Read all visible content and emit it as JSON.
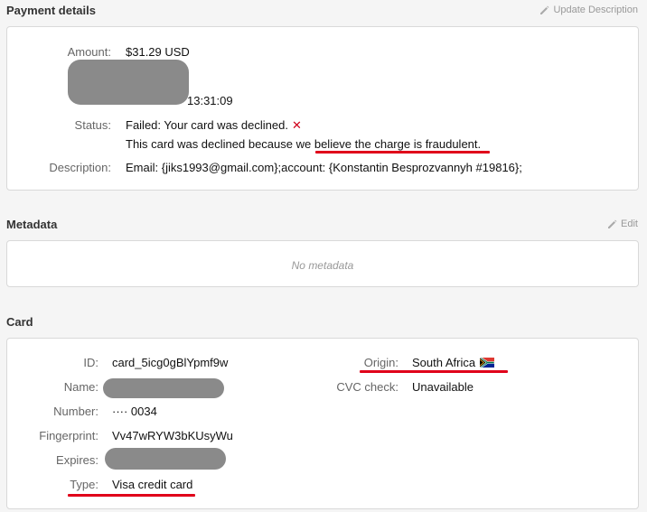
{
  "payment": {
    "title": "Payment details",
    "action_label": "Update Description",
    "amount_label": "Amount:",
    "amount_value": "$31.29 USD",
    "time_value": "13:31:09",
    "status_label": "Status:",
    "status_value": "Failed: Your card was declined.",
    "status_icon": "x-icon",
    "reason_prefix": "This card was declined because we ",
    "reason_highlight": "believe the charge is fraudulent.",
    "description_label": "Description:",
    "description_value": "Email: {jiks1993@gmail.com};account: {Konstantin Besprozvannyh #19816};"
  },
  "metadata": {
    "title": "Metadata",
    "action_label": "Edit",
    "empty_text": "No metadata"
  },
  "card": {
    "title": "Card",
    "id_label": "ID:",
    "id_value": "card_5icg0gBlYpmf9w",
    "name_label": "Name:",
    "number_label": "Number:",
    "number_value": "···· 0034",
    "fingerprint_label": "Fingerprint:",
    "fingerprint_value": "Vv47wRYW3bKUsyWu",
    "expires_label": "Expires:",
    "type_label": "Type:",
    "type_value": "Visa credit card",
    "origin_label": "Origin:",
    "origin_value": "South Africa",
    "origin_flag": "south-africa-flag-icon",
    "cvc_label": "CVC check:",
    "cvc_value": "Unavailable"
  },
  "colors": {
    "annotation_red": "#e0001a",
    "decline_x": "#d0021b",
    "redaction_gray": "#8a8a8a"
  }
}
